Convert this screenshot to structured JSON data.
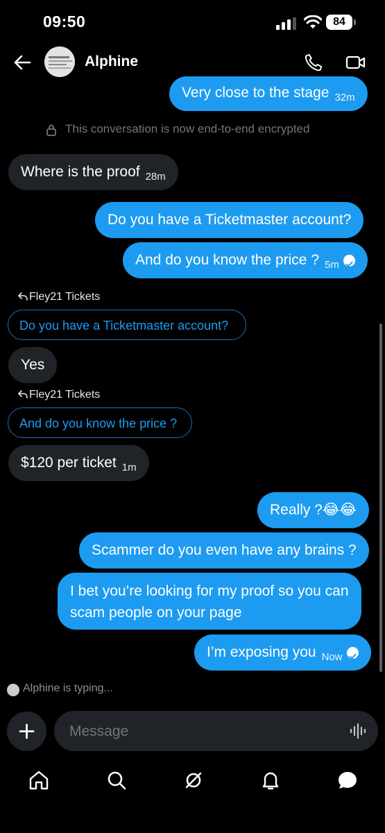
{
  "status_bar": {
    "time": "09:50",
    "battery": "84"
  },
  "header": {
    "contact_name": "Alphine"
  },
  "messages": {
    "m1": {
      "text": "Very close to the stage",
      "time": "32m"
    },
    "encrypted_notice": "This conversation is now end-to-end encrypted",
    "m2": {
      "text": "Where is the proof",
      "time": "28m"
    },
    "m3": {
      "text": "Do you have a Ticketmaster account?"
    },
    "m4": {
      "text": "And do you know the price ?",
      "time": "5m"
    },
    "reply1": {
      "label": "Fley21 Tickets",
      "quote": "Do you have a Ticketmaster account?"
    },
    "m5": {
      "text": "Yes"
    },
    "reply2": {
      "label": "Fley21 Tickets",
      "quote": "And do you know the price ?"
    },
    "m6": {
      "text": "$120 per ticket",
      "time": "1m"
    },
    "m7": {
      "text": "Really ?😂😂"
    },
    "m8": {
      "text": "Scammer do you even have any brains ?"
    },
    "m9": {
      "line1": "I bet you’re looking for my proof so you can",
      "line2": "scam people on your page"
    },
    "m10": {
      "text": "I’m exposing you",
      "time": "Now"
    }
  },
  "typing_indicator": "Alphine is typing...",
  "composer": {
    "placeholder": "Message"
  },
  "icons": {
    "back": "arrow-left-icon",
    "call": "phone-icon",
    "video": "video-camera-icon",
    "lock": "lock-icon",
    "reply": "reply-arrow-icon",
    "add": "plus-icon",
    "voice": "waveform-icon",
    "nav": [
      "home-icon",
      "search-icon",
      "grok-icon",
      "bell-icon",
      "messages-icon"
    ]
  },
  "colors": {
    "accent": "#1d9bf0",
    "incoming_bubble": "#202327",
    "background": "#000000"
  }
}
